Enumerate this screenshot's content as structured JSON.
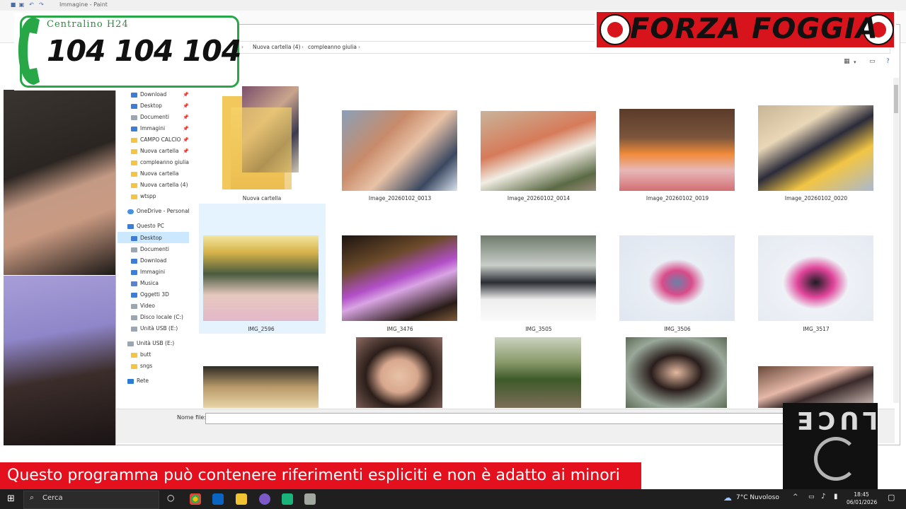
{
  "window": {
    "title": "Immagine - Paint"
  },
  "explorer": {
    "breadcrumbs": [
      "Nuova cartella (4)",
      "compleanno giulia"
    ],
    "nav_items": [
      {
        "label": "Download",
        "icon": "download-icon",
        "pinned": true
      },
      {
        "label": "Desktop",
        "icon": "desktop-icon",
        "pinned": true
      },
      {
        "label": "Documenti",
        "icon": "documents-icon",
        "pinned": true
      },
      {
        "label": "Immagini",
        "icon": "pictures-icon",
        "pinned": true
      },
      {
        "label": "CAMPO CALCIO",
        "icon": "folder-icon",
        "pinned": true
      },
      {
        "label": "Nuova cartella",
        "icon": "folder-icon",
        "pinned": true
      },
      {
        "label": "compleanno giulia",
        "icon": "folder-icon",
        "pinned": false
      },
      {
        "label": "Nuova cartella",
        "icon": "folder-icon",
        "pinned": false
      },
      {
        "label": "Nuova cartella (4)",
        "icon": "folder-icon",
        "pinned": false
      },
      {
        "label": "wtspp",
        "icon": "folder-icon",
        "pinned": false
      }
    ],
    "onedrive": "OneDrive - Personal",
    "this_pc": "Questo PC",
    "pc_items": [
      {
        "label": "Desktop",
        "icon": "desktop-icon",
        "selected": true
      },
      {
        "label": "Documenti",
        "icon": "documents-icon"
      },
      {
        "label": "Download",
        "icon": "download-icon"
      },
      {
        "label": "Immagini",
        "icon": "pictures-icon"
      },
      {
        "label": "Musica",
        "icon": "music-icon"
      },
      {
        "label": "Oggetti 3D",
        "icon": "objects3d-icon"
      },
      {
        "label": "Video",
        "icon": "video-icon"
      },
      {
        "label": "Disco locale (C:)",
        "icon": "drive-icon"
      },
      {
        "label": "Unità USB (E:)",
        "icon": "usb-icon"
      }
    ],
    "usb": "Unità USB (E:)",
    "usb_items": [
      {
        "label": "butt",
        "icon": "folder-icon"
      },
      {
        "label": "sngs",
        "icon": "folder-icon"
      }
    ],
    "network": "Rete",
    "files": [
      {
        "name": "Nuova cartella",
        "kind": "folder"
      },
      {
        "name": "Image_20260102_0013",
        "kind": "photo"
      },
      {
        "name": "Image_20260102_0014",
        "kind": "photo"
      },
      {
        "name": "Image_20260102_0019",
        "kind": "photo"
      },
      {
        "name": "Image_20260102_0020",
        "kind": "photo"
      },
      {
        "name": "IMG_2596",
        "kind": "photo",
        "selected": true
      },
      {
        "name": "IMG_3476",
        "kind": "photo"
      },
      {
        "name": "IMG_3505",
        "kind": "photo"
      },
      {
        "name": "IMG_3506",
        "kind": "photo"
      },
      {
        "name": "IMG_3517",
        "kind": "photo"
      }
    ],
    "filename_label": "Nome file:"
  },
  "overlays": {
    "phone_label": "Centralino H24",
    "phone_number": "104 104 104",
    "banner_text": "FORZA FOGGIA",
    "warning_text": "Questo programma  può contenere riferimenti espliciti e non è adatto ai minori",
    "luce_text": "LUCE"
  },
  "taskbar": {
    "search_placeholder": "Cerca",
    "weather": "7°C  Nuvoloso",
    "time": "18:45",
    "date": "06/01/2026"
  },
  "colors": {
    "accent_green": "#27a745",
    "banner_red": "#d7141c",
    "warning_red": "#e5101d",
    "selection": "#cce8ff"
  }
}
